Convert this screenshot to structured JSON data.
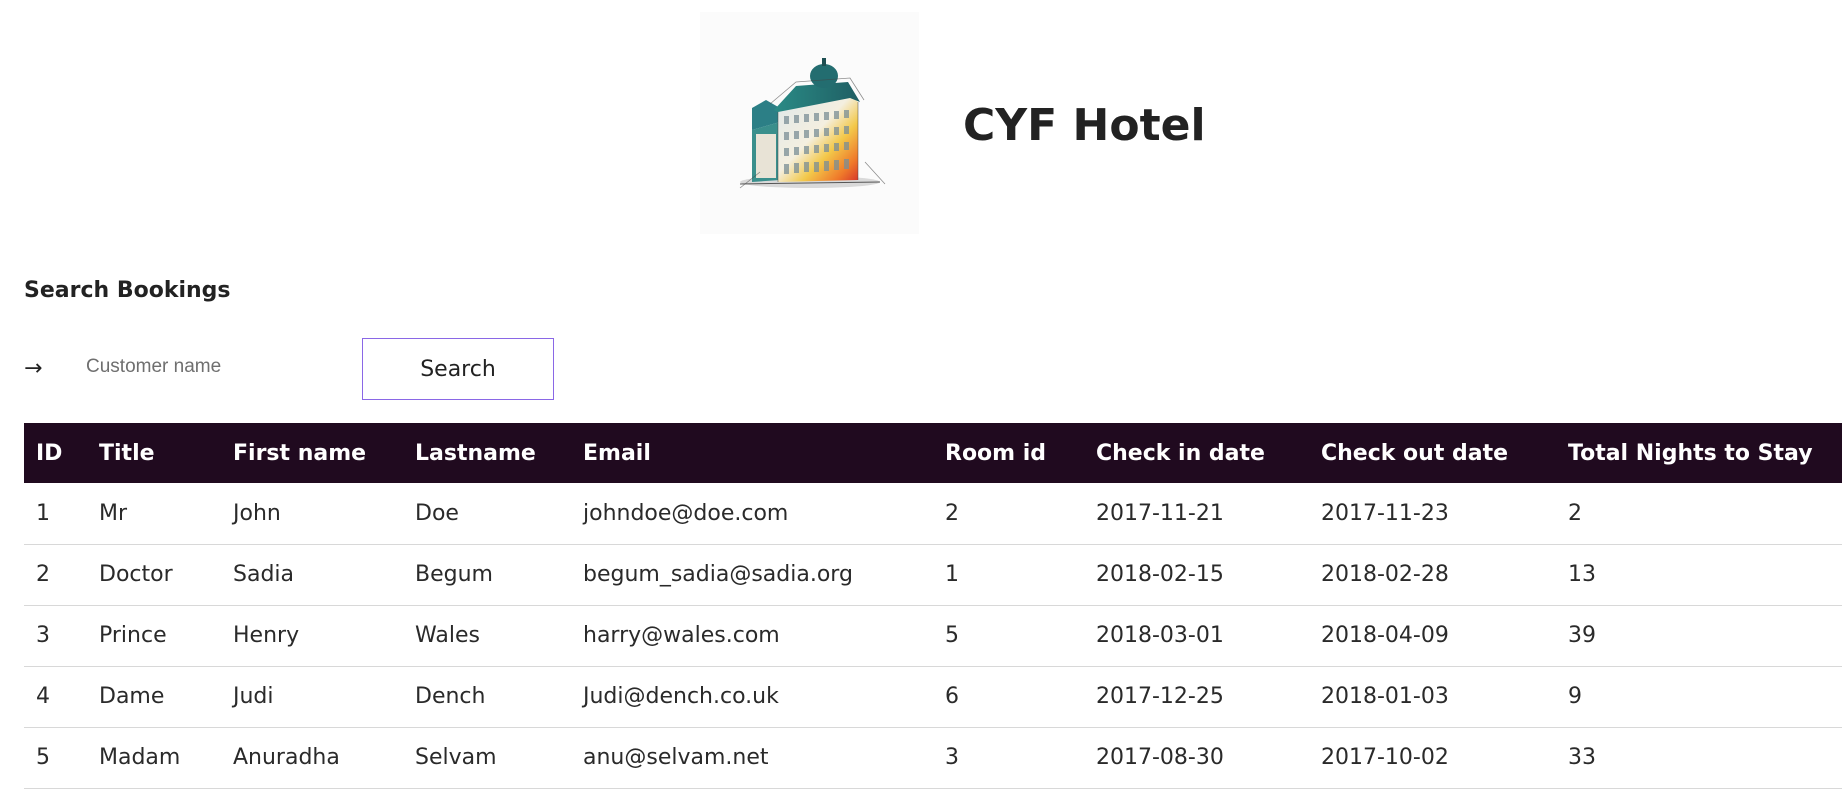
{
  "header": {
    "title": "CYF Hotel",
    "logo_icon": "hotel-building-illustration-icon"
  },
  "search": {
    "heading": "Search Bookings",
    "arrow_icon": "right-arrow-icon",
    "placeholder": "Customer name",
    "value": "",
    "button_label": "Search",
    "button_border_color": "#8a67e6"
  },
  "table": {
    "header_bg": "#200a1f",
    "columns": [
      "ID",
      "Title",
      "First name",
      "Lastname",
      "Email",
      "Room id",
      "Check in date",
      "Check out date",
      "Total Nights to Stay"
    ],
    "rows": [
      [
        "1",
        "Mr",
        "John",
        "Doe",
        "johndoe@doe.com",
        "2",
        "2017-11-21",
        "2017-11-23",
        "2"
      ],
      [
        "2",
        "Doctor",
        "Sadia",
        "Begum",
        "begum_sadia@sadia.org",
        "1",
        "2018-02-15",
        "2018-02-28",
        "13"
      ],
      [
        "3",
        "Prince",
        "Henry",
        "Wales",
        "harry@wales.com",
        "5",
        "2018-03-01",
        "2018-04-09",
        "39"
      ],
      [
        "4",
        "Dame",
        "Judi",
        "Dench",
        "Judi@dench.co.uk",
        "6",
        "2017-12-25",
        "2018-01-03",
        "9"
      ],
      [
        "5",
        "Madam",
        "Anuradha",
        "Selvam",
        "anu@selvam.net",
        "3",
        "2017-08-30",
        "2017-10-02",
        "33"
      ]
    ]
  }
}
